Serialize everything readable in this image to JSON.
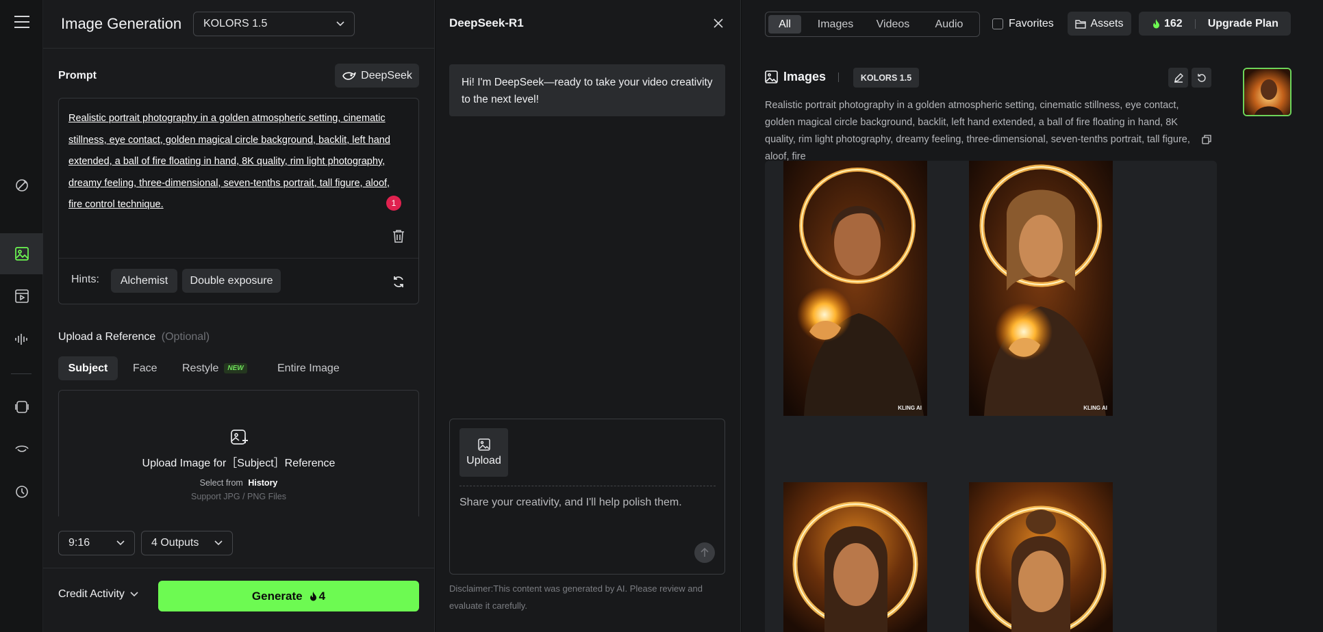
{
  "header": {
    "title": "Image Generation",
    "model_select": "KOLORS 1.5"
  },
  "prompt": {
    "label": "Prompt",
    "deepseek_button": "DeepSeek",
    "text": "Realistic portrait photography in a golden atmospheric setting, cinematic stillness, eye contact, golden magical circle background, backlit, left hand extended, a ball of fire floating in hand, 8K quality, rim light photography, dreamy feeling, three-dimensional, seven-tenths portrait, tall figure, aloof, fire control technique.",
    "badge_count": "1",
    "hints_label": "Hints:",
    "hints": [
      "Alchemist",
      "Double exposure"
    ]
  },
  "reference": {
    "label": "Upload a Reference",
    "optional": "(Optional)",
    "tabs": [
      "Subject",
      "Face",
      "Restyle",
      "Entire Image"
    ],
    "new_tag": "NEW",
    "upload_title": "Upload Image for［Subject］Reference",
    "select_from": "Select from",
    "history": "History",
    "support": "Support JPG / PNG Files"
  },
  "settings": {
    "ratio": "9:16",
    "outputs": "4 Outputs"
  },
  "footer": {
    "credit_activity": "Credit Activity",
    "generate": "Generate",
    "generate_cost": "4"
  },
  "chat": {
    "title": "DeepSeek-R1",
    "greeting": "Hi! I'm DeepSeek—ready to take your video creativity to the next level!",
    "upload": "Upload",
    "placeholder": "Share your creativity, and I'll help polish them.",
    "disclaimer": "Disclaimer:This content was generated by AI. Please review and evaluate it carefully."
  },
  "gallery": {
    "filters": [
      "All",
      "Images",
      "Videos",
      "Audio"
    ],
    "active_filter": "All",
    "favorites": "Favorites",
    "assets": "Assets",
    "credits": "162",
    "upgrade": "Upgrade Plan",
    "section_title": "Images",
    "model": "KOLORS 1.5",
    "description": "Realistic portrait photography in a golden atmospheric setting, cinematic stillness, eye contact, golden magical circle background, backlit, left hand extended, a ball of fire floating in hand, 8K quality, rim light photography, dreamy feeling, three-dimensional, seven-tenths portrait, tall figure, aloof, fire",
    "watermark": "KLING AI"
  },
  "colors": {
    "accent_green": "#6dfa52",
    "badge_red": "#e0224f",
    "background": "#17181a"
  }
}
